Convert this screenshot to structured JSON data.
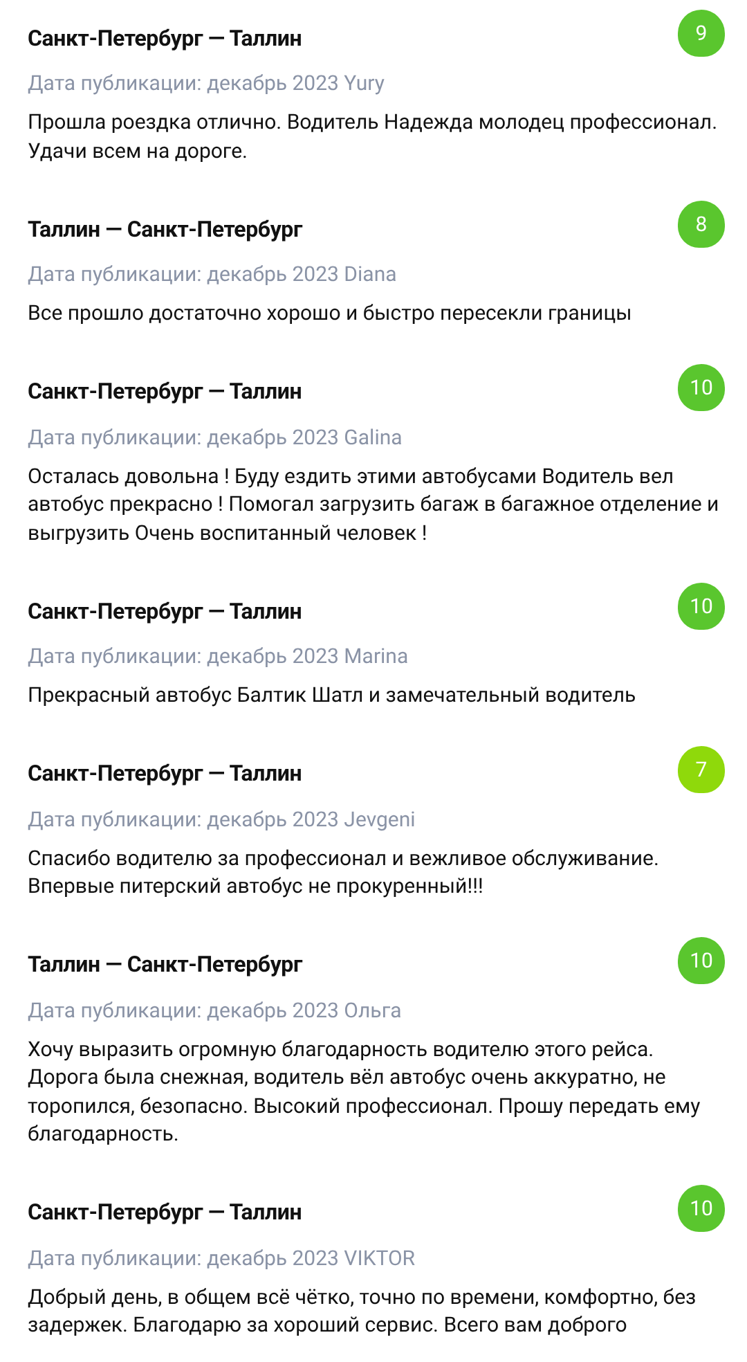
{
  "reviews": [
    {
      "route": "Санкт-Петербург — Таллин",
      "score": "9",
      "color": "#5ac62e",
      "meta": "Дата публикации: декабрь 2023 Yury",
      "text": "Прошла роездка отлично. Водитель Надежда молодец профессионал. Удачи всем на дороге."
    },
    {
      "route": "Таллин — Санкт-Петербург",
      "score": "8",
      "color": "#5ac62e",
      "meta": "Дата публикации: декабрь 2023 Diana",
      "text": "Все прошло достаточно хорошо и быстро пересекли границы"
    },
    {
      "route": "Санкт-Петербург — Таллин",
      "score": "10",
      "color": "#5ac62e",
      "meta": "Дата публикации: декабрь 2023 Galina",
      "text": "Осталась довольна ! Буду ездить этими автобусами Водитель вел автобус прекрасно ! Помогал загрузить багаж в багажное отделение и выгрузить Очень воспитанный человек !"
    },
    {
      "route": "Санкт-Петербург — Таллин",
      "score": "10",
      "color": "#5ac62e",
      "meta": "Дата публикации: декабрь 2023 Marina",
      "text": "Прекрасный автобус Балтик Шатл и замечательный водитель"
    },
    {
      "route": "Санкт-Петербург — Таллин",
      "score": "7",
      "color": "#8fd90b",
      "meta": "Дата публикации: декабрь 2023 Jevgeni",
      "text": "Спасибо водителю за профессионал и вежливое обслуживание. Впервые питерский автобус не прокуренный!!!"
    },
    {
      "route": "Таллин — Санкт-Петербург",
      "score": "10",
      "color": "#5ac62e",
      "meta": "Дата публикации: декабрь 2023 Ольга",
      "text": "Хочу выразить огромную благодарность водителю этого рейса. Дорога была снежная, водитель вёл автобус очень аккуратно, не торопился, безопасно. Высокий профессионал. Прошу передать ему благодарность."
    },
    {
      "route": "Санкт-Петербург — Таллин",
      "score": "10",
      "color": "#5ac62e",
      "meta": "Дата публикации: декабрь 2023 VIKTOR",
      "text": "Добрый день, в общем всё чётко, точно по времени, комфортно, без задержек. Благодарю за хороший сервис. Всего вам доброго"
    }
  ]
}
